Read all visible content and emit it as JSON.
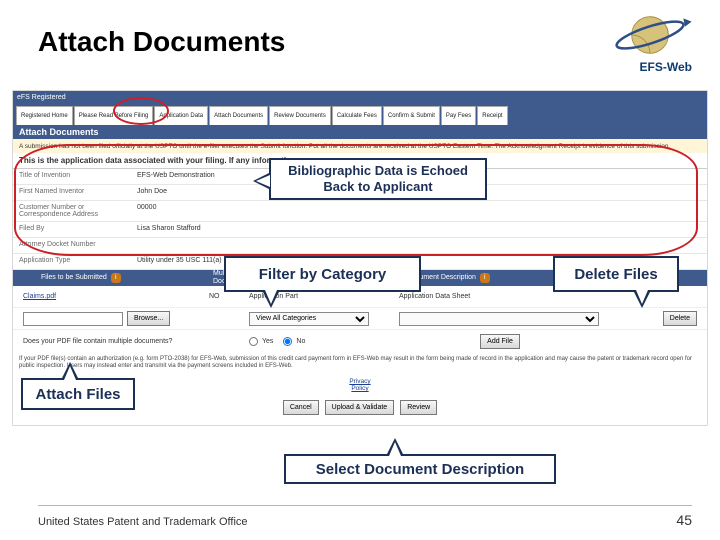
{
  "slide": {
    "title": "Attach Documents",
    "footer": "United States Patent and Trademark Office",
    "page_number": "45",
    "logo_text": "EFS-Web"
  },
  "callouts": {
    "biblio": "Bibliographic Data is Echoed Back to Applicant",
    "filter": "Filter by Category",
    "delete": "Delete Files",
    "attach": "Attach Files",
    "descr": "Select Document Description"
  },
  "screenshot": {
    "userbar_left": "eFS Registered",
    "userbar_right": "",
    "tabs": [
      "Registered\nHome",
      "Please Read\nBefore Filing",
      "Application\nData",
      "Attach\nDocuments",
      "Review\nDocuments",
      "Calculate\nFees",
      "Confirm &\nSubmit",
      "Pay\nFees",
      "Receipt"
    ],
    "section_bar": "Attach Documents",
    "note_strip": "A submission has not been filed officially at the USPTO until the e-filer executes the Submit function. Put all the documents are received at the USPTO Eastern Time. The Acknowledgment Receipt is evidence of this submission.",
    "biblio_head": "This is the application data associated with your filing. If any information …",
    "biblio": [
      {
        "label": "Title of Invention",
        "value": "EFS-Web Demonstration"
      },
      {
        "label": "First Named Inventor",
        "value": "John Doe"
      },
      {
        "label": "Customer Number or Correspondence Address",
        "value": "00000"
      },
      {
        "label": "Filed By",
        "value": "Lisa Sharon Stafford"
      },
      {
        "label": "Attorney Docket Number",
        "value": ""
      },
      {
        "label": "Application Type",
        "value": "Utility under 35 USC 111(a)"
      }
    ],
    "files": {
      "col_files": "Files to be Submitted",
      "col_multi": "Multi\nDoc",
      "col_descr": "Document Description",
      "rows": [
        {
          "file_link": "Claims.pdf",
          "multi": "NO",
          "category_label": "Application Part",
          "category_select_value": "View All Categories",
          "descr_label": "Application Data Sheet",
          "descr_select_value": "",
          "delete": "Delete"
        }
      ],
      "browse_row": {
        "browse": "Browse..."
      },
      "multi_question": "Does your PDF file contain multiple documents?",
      "multi_yes": "Yes",
      "multi_no": "No",
      "add_file": "Add File"
    },
    "pto_note": "If your PDF file(s) contain an authorization (e.g. form PTO-2038) for EFS-Web, submission of this credit card payment form in EFS-Web may result in the form being made of record in the application and may cause the patent or trademark record open for public inspection. Users may instead enter and transmit via the payment screens included in EFS-Web.",
    "privacy_policy": "Privacy\nPolicy",
    "buttons": {
      "cancel": "Cancel",
      "upload": "Upload & Validate",
      "review": "Review"
    }
  }
}
